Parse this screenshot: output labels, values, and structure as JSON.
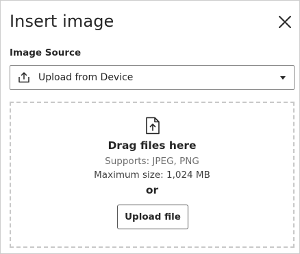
{
  "dialog": {
    "title": "Insert image",
    "close_icon": "close-icon"
  },
  "image_source": {
    "label": "Image Source",
    "selected": "Upload from Device",
    "icon": "upload-tray-icon"
  },
  "dropzone": {
    "icon": "file-upload-icon",
    "heading": "Drag files here",
    "supports": "Supports: JPEG, PNG",
    "max_size": "Maximum size: 1,024 MB",
    "or": "or",
    "button_label": "Upload file"
  },
  "colors": {
    "text": "#262626",
    "muted": "#6e6e6e",
    "border": "#8a8a8a",
    "dashed_border": "#c8c8c8"
  }
}
